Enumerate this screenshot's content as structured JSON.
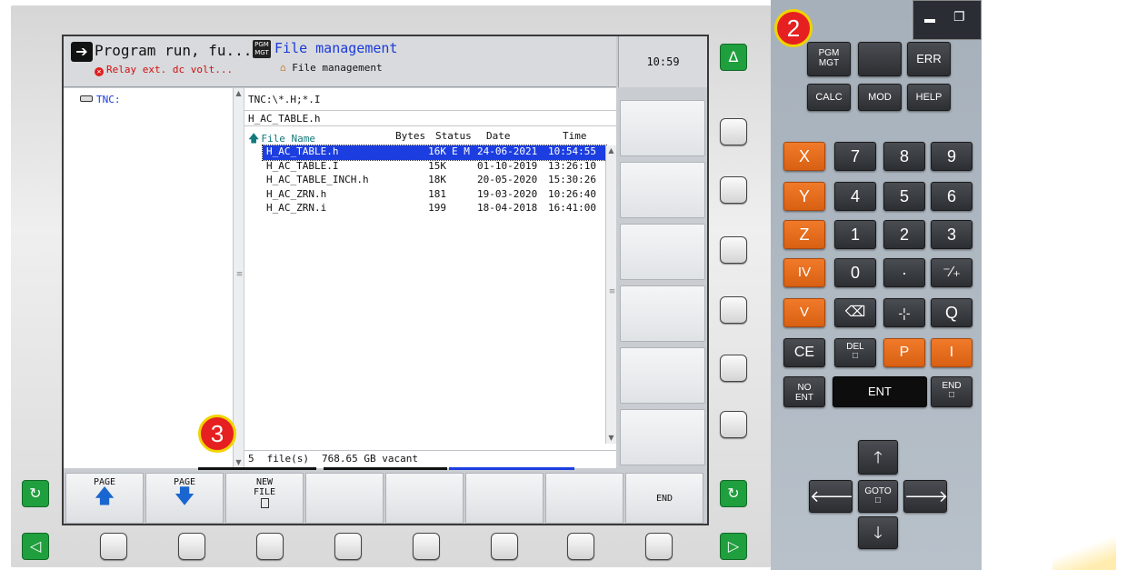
{
  "header": {
    "mode1_title": "Program run, fu...",
    "mode1_error": "Relay ext. dc volt...",
    "mode2_badge": "PGM MGT",
    "mode2_title": "File management",
    "mode2_sub": "File management",
    "clock": "10:59"
  },
  "tree": {
    "items": [
      {
        "label": "TNC:"
      }
    ]
  },
  "files": {
    "path_filter": "TNC:\\*.H;*.I",
    "selected_file": "H_AC_TABLE.h",
    "columns": {
      "name": "File Name",
      "bytes": "Bytes",
      "status": "Status",
      "date": "Date",
      "time": "Time"
    },
    "rows": [
      {
        "name": "H_AC_TABLE.h",
        "bytes": "16K",
        "status": "E M",
        "date": "24-06-2021",
        "time": "10:54:55",
        "selected": true
      },
      {
        "name": "H_AC_TABLE.I",
        "bytes": "15K",
        "status": "",
        "date": "01-10-2019",
        "time": "13:26:10"
      },
      {
        "name": "H_AC_TABLE_INCH.h",
        "bytes": "18K",
        "status": "",
        "date": "20-05-2020",
        "time": "15:30:26"
      },
      {
        "name": "H_AC_ZRN.h",
        "bytes": "181",
        "status": "",
        "date": "19-03-2020",
        "time": "10:26:40"
      },
      {
        "name": "H_AC_ZRN.i",
        "bytes": "199",
        "status": "",
        "date": "18-04-2018",
        "time": "16:41:00"
      }
    ],
    "status": {
      "count": "5",
      "count_label": "file(s)",
      "vacant": "768.65 GB vacant"
    }
  },
  "softkeys": {
    "page_up": "PAGE",
    "page_down": "PAGE",
    "new_file_1": "NEW",
    "new_file_2": "FILE",
    "end": "END"
  },
  "keypad": {
    "row_a": [
      "PGM MGT",
      "",
      "ERR"
    ],
    "row_b": [
      "CALC",
      "MOD",
      "HELP"
    ],
    "axis": [
      "X",
      "Y",
      "Z",
      "IV",
      "V"
    ],
    "digits": [
      [
        "7",
        "8",
        "9"
      ],
      [
        "4",
        "5",
        "6"
      ],
      [
        "1",
        "2",
        "3"
      ],
      [
        "0",
        "·",
        "⁻⁄₊"
      ]
    ],
    "row_v": [
      "⌫",
      "-¦-",
      "Q"
    ],
    "ce": "CE",
    "del": "DEL",
    "p": "P",
    "i": "I",
    "no_ent": "NO ENT",
    "ent": "ENT",
    "end": "END",
    "goto": "GOTO"
  },
  "callouts": {
    "two": "2",
    "three": "3"
  },
  "colors": {
    "accent_blue": "#1c3ee0",
    "axis_orange": "#e86c1e",
    "error_red": "#d01010",
    "green": "#1f9f3e",
    "callout_red": "#e62020",
    "callout_ring": "#f1d400"
  }
}
